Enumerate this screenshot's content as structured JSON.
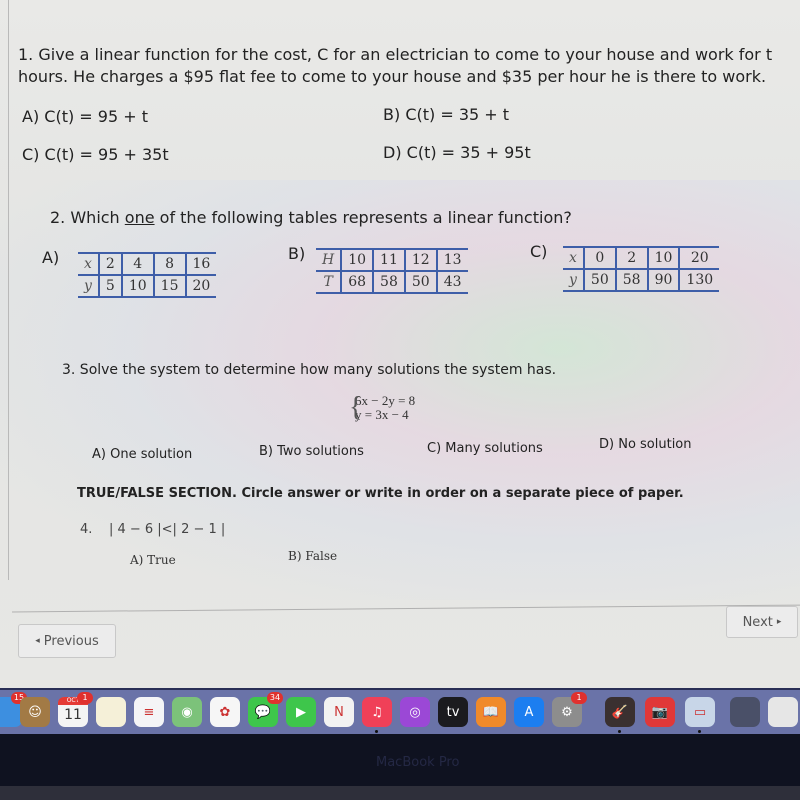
{
  "question1": {
    "number": "1.",
    "text_line1": "Give a linear function for the cost, C for an electrician to come to your house and work for t",
    "text_line2": "hours.  He charges a $95 flat fee to come to your house and $35 per hour he is there to work.",
    "options": [
      {
        "label": "A)",
        "text": "C(t) = 95 + t"
      },
      {
        "label": "B)",
        "text": "C(t) = 35 + t"
      },
      {
        "label": "C)",
        "text": "C(t) = 95 + 35t"
      },
      {
        "label": "D)",
        "text": "C(t) = 35 + 95t"
      }
    ]
  },
  "question2": {
    "prefix": "2.  Which ",
    "underlined": "one",
    "suffix": " of the following tables represents a linear function?",
    "tables": [
      {
        "label": "A)",
        "rows": [
          [
            "x",
            "2",
            "4",
            "8",
            "16"
          ],
          [
            "y",
            "5",
            "10",
            "15",
            "20"
          ]
        ]
      },
      {
        "label": "B)",
        "rows": [
          [
            "H",
            "10",
            "11",
            "12",
            "13"
          ],
          [
            "T",
            "68",
            "58",
            "50",
            "43"
          ]
        ]
      },
      {
        "label": "C)",
        "rows": [
          [
            "x",
            "0",
            "2",
            "10",
            "20"
          ],
          [
            "y",
            "50",
            "58",
            "90",
            "130"
          ]
        ]
      }
    ]
  },
  "question3": {
    "text": "3.  Solve the system to determine how many solutions the system has.",
    "system": [
      "6x − 2y = 8",
      "y = 3x − 4"
    ],
    "options": [
      "A)  One solution",
      "B) Two solutions",
      "C)  Many solutions",
      "D)  No solution"
    ]
  },
  "true_false": {
    "heading_bold": "TRUE/FALSE SECTION.",
    "heading_rest": "  Circle answer or write in order on a separate piece of paper.",
    "q4_number": "4.",
    "q4_text": "| 4 − 6 |<| 2 − 1 |",
    "options": [
      "A)  True",
      "B)  False"
    ]
  },
  "nav": {
    "previous_label": "Previous",
    "next_label": "Next",
    "prev_icon": "◂",
    "next_icon": "▸"
  },
  "dock": {
    "items": [
      {
        "name": "finder",
        "glyph": "",
        "color": "#3d8fe0",
        "badge": "15"
      },
      {
        "name": "contacts",
        "glyph": "☺",
        "color": "#a27a45",
        "badge": ""
      },
      {
        "name": "calendar",
        "glyph": "11",
        "color": "#f4f4f4",
        "badge": "1",
        "month": "OCT"
      },
      {
        "name": "notes",
        "glyph": "",
        "color": "#f5f0d8",
        "badge": ""
      },
      {
        "name": "reminders",
        "glyph": "≡",
        "color": "#f4f4f6",
        "badge": ""
      },
      {
        "name": "maps",
        "glyph": "◉",
        "color": "#7cc27a",
        "badge": ""
      },
      {
        "name": "photos",
        "glyph": "✿",
        "color": "#f6f6f6",
        "badge": ""
      },
      {
        "name": "messages",
        "glyph": "💬",
        "color": "#3ec64b",
        "badge": "34"
      },
      {
        "name": "facetime",
        "glyph": "▶",
        "color": "#3ec64b",
        "badge": ""
      },
      {
        "name": "news",
        "glyph": "N",
        "color": "#f2f2f2",
        "badge": ""
      },
      {
        "name": "music",
        "glyph": "♫",
        "color": "#f04058",
        "badge": "",
        "running": true
      },
      {
        "name": "podcasts",
        "glyph": "◎",
        "color": "#9b48d6",
        "badge": ""
      },
      {
        "name": "tv",
        "glyph": "tv",
        "color": "#1b1b1f",
        "badge": ""
      },
      {
        "name": "books",
        "glyph": "📖",
        "color": "#f08a2a",
        "badge": ""
      },
      {
        "name": "app-store",
        "glyph": "A",
        "color": "#1c7ef0",
        "badge": ""
      },
      {
        "name": "system-preferences",
        "glyph": "⚙",
        "color": "#8d8d8d",
        "badge": "1"
      },
      {
        "name": "garageband",
        "glyph": "🎸",
        "color": "#3a3030",
        "badge": "",
        "running": true
      },
      {
        "name": "photo-booth",
        "glyph": "📷",
        "color": "#e03838",
        "badge": ""
      },
      {
        "name": "preview",
        "glyph": "▭",
        "color": "#c8d6e8",
        "badge": "",
        "running": true
      },
      {
        "name": "window-thumbnail",
        "glyph": "",
        "color": "#4a5068",
        "badge": ""
      },
      {
        "name": "document-thumbnail",
        "glyph": "",
        "color": "#e6e6e6",
        "badge": ""
      }
    ]
  },
  "bezel": {
    "label": "MacBook Pro"
  }
}
